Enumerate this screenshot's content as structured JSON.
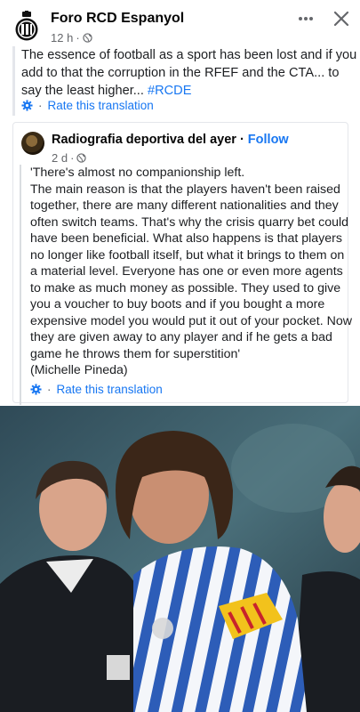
{
  "post": {
    "page_name": "Foro RCD Espanyol",
    "time": "12 h",
    "text": "The essence of football as a sport has been lost and if you add to that the corruption in the RFEF and the CTA... to say the least higher...",
    "hashtag": "#RCDE",
    "translate_label": "Rate this translation"
  },
  "shared": {
    "author": "Radiografia deportiva del ayer",
    "follow_label": "Follow",
    "time": "2 d",
    "quote": "'There's almost no companionship left.\nThe main reason is that the players haven't been raised together, there are many different nationalities and they often switch teams. That's why the crisis quarry bet could have been beneficial. What also happens is that players no longer like football itself, but what it brings to them on a material level. Everyone has one or even more agents to make as much money as possible. They used to give you a voucher to buy boots and if you bought a more expensive model you would put it out of your pocket. Now they are given away to any player and if he gets a bad game he throws them for superstition'\n(Michelle Pineda)",
    "translate_label": "Rate this translation"
  },
  "icons": {
    "more": "more-horizontal-icon",
    "close": "close-icon",
    "privacy": "globe-icon",
    "translate": "gear-icon"
  },
  "colors": {
    "link": "#1877f2",
    "muted": "#65676b",
    "text": "#1c1e21"
  }
}
